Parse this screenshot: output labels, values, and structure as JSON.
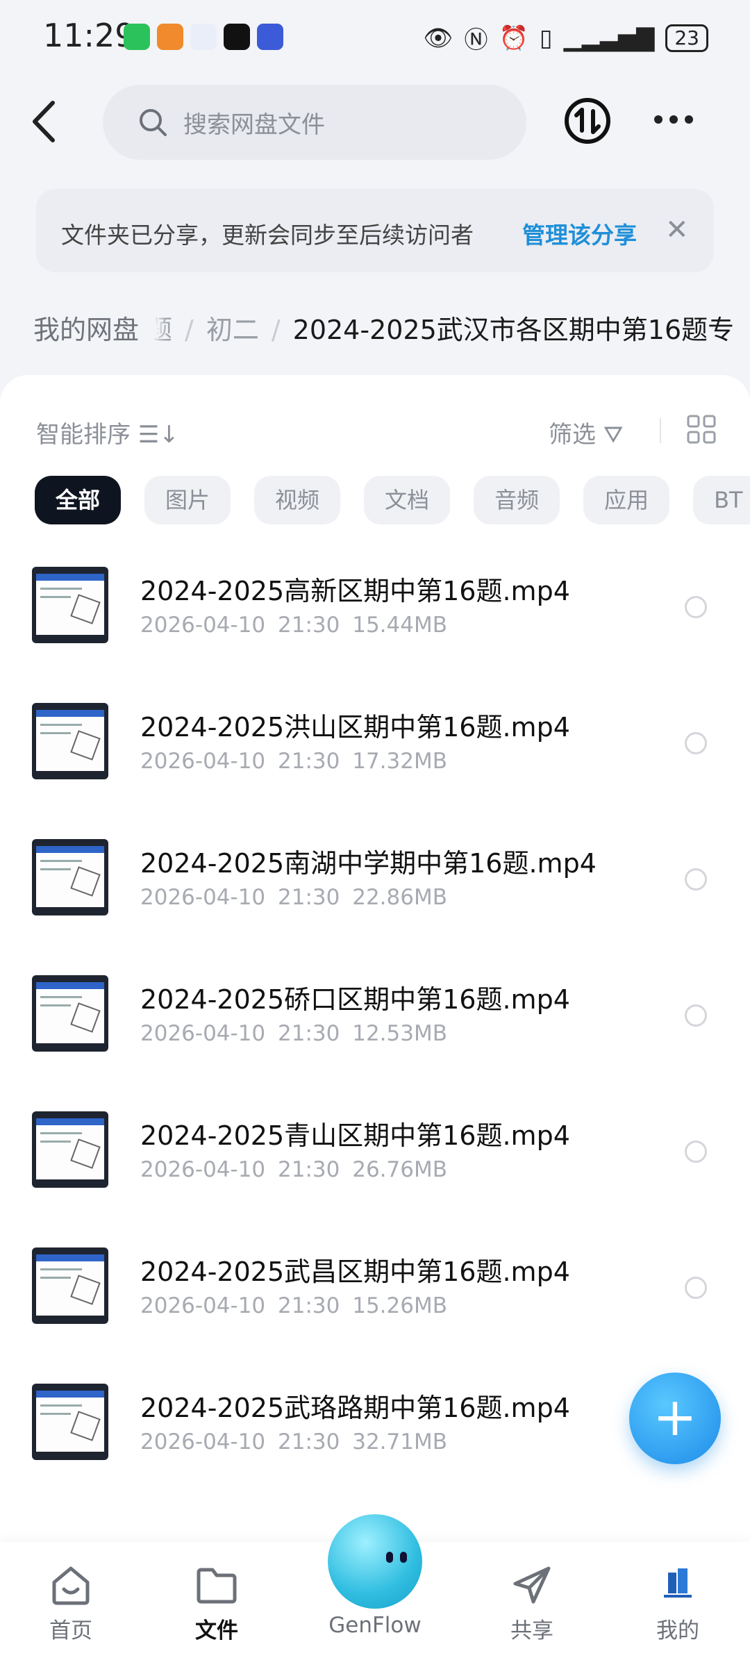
{
  "status_bar": {
    "time": "11:29",
    "battery": "23"
  },
  "search": {
    "placeholder": "搜索网盘文件"
  },
  "notice": {
    "message": "文件夹已分享，更新会同步至后续访问者",
    "action": "管理该分享"
  },
  "breadcrumb": {
    "root": "我的网盘",
    "items": [
      "题",
      "初二",
      "2024-2025武汉市各区期中第16题专"
    ]
  },
  "toolbar": {
    "sort_label": "智能排序",
    "filter_label": "筛选"
  },
  "chips": [
    "全部",
    "图片",
    "视频",
    "文档",
    "音频",
    "应用",
    "BT"
  ],
  "files": [
    {
      "name": "2024-2025高新区期中第16题.mp4",
      "date": "2026-04-10",
      "time": "21:30",
      "size": "15.44MB"
    },
    {
      "name": "2024-2025洪山区期中第16题.mp4",
      "date": "2026-04-10",
      "time": "21:30",
      "size": "17.32MB"
    },
    {
      "name": "2024-2025南湖中学期中第16题.mp4",
      "date": "2026-04-10",
      "time": "21:30",
      "size": "22.86MB"
    },
    {
      "name": "2024-2025硚口区期中第16题.mp4",
      "date": "2026-04-10",
      "time": "21:30",
      "size": "12.53MB"
    },
    {
      "name": "2024-2025青山区期中第16题.mp4",
      "date": "2026-04-10",
      "time": "21:30",
      "size": "26.76MB"
    },
    {
      "name": "2024-2025武昌区期中第16题.mp4",
      "date": "2026-04-10",
      "time": "21:30",
      "size": "15.26MB"
    },
    {
      "name": "2024-2025武珞路期中第16题.mp4",
      "date": "2026-04-10",
      "time": "21:30",
      "size": "32.71MB"
    }
  ],
  "nav": {
    "home": "首页",
    "files": "文件",
    "genflow": "GenFlow",
    "share": "共享",
    "mine": "我的"
  },
  "colors": {
    "accent": "#1f8fd8",
    "active_chip": "#0f1520",
    "fab": "#1d8be8"
  }
}
